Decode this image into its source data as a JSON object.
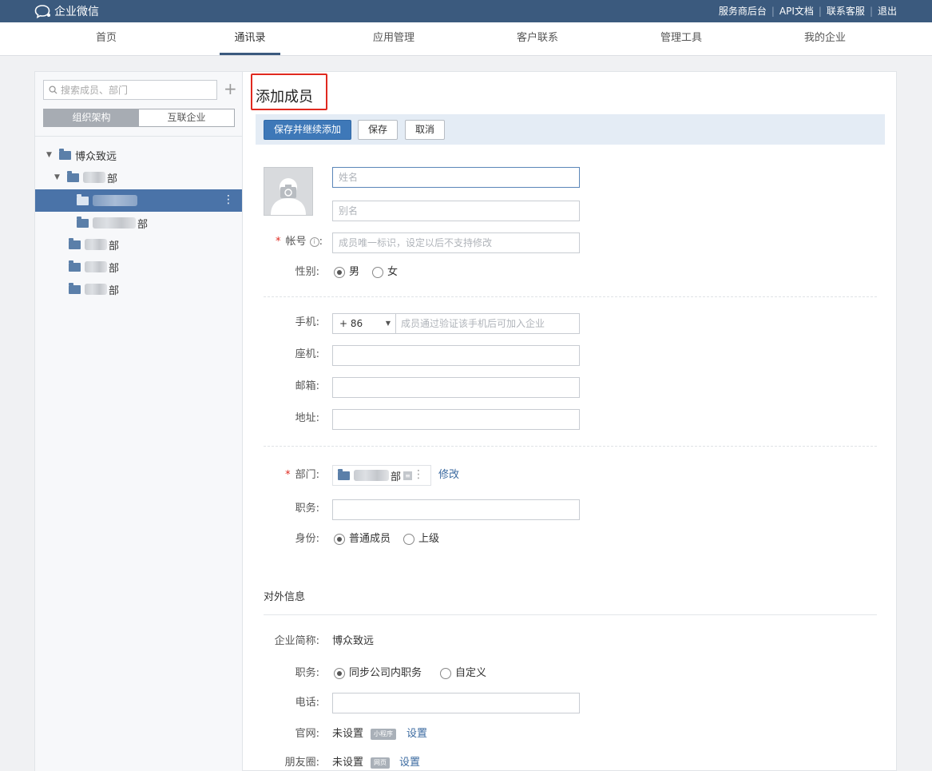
{
  "topbar": {
    "app_name": "企业微信",
    "links": [
      "服务商后台",
      "API文档",
      "联系客服",
      "退出"
    ],
    "separator": "|"
  },
  "nav": {
    "tabs": [
      "首页",
      "通讯录",
      "应用管理",
      "客户联系",
      "管理工具",
      "我的企业"
    ],
    "active": "通讯录"
  },
  "sidebar": {
    "search_placeholder": "搜索成员、部门",
    "segments": [
      "组织架构",
      "互联企业"
    ],
    "active_segment": "组织架构",
    "tree": {
      "root": "博众致远",
      "dept_suffix": "部"
    }
  },
  "form": {
    "title": "添加成员",
    "buttons": {
      "save_continue": "保存并继续添加",
      "save": "保存",
      "cancel": "取消"
    },
    "name_placeholder": "姓名",
    "alias_placeholder": "别名",
    "account_label": "帐号",
    "account_placeholder": "成员唯一标识，设定以后不支持修改",
    "gender_label": "性别:",
    "gender_options": [
      "男",
      "女"
    ],
    "gender_selected": "男",
    "mobile_label": "手机:",
    "country_code": "+ 86",
    "mobile_placeholder": "成员通过验证该手机后可加入企业",
    "landline_label": "座机:",
    "email_label": "邮箱:",
    "address_label": "地址:",
    "dept_label": "部门:",
    "dept_value_suffix": "部",
    "dept_modify": "修改",
    "position_label": "职务:",
    "identity_label": "身份:",
    "identity_options": [
      "普通成员",
      "上级"
    ],
    "identity_selected": "普通成员",
    "external": {
      "section_title": "对外信息",
      "corp_short_label": "企业简称:",
      "corp_short_value": "博众致远",
      "position_label": "职务:",
      "position_options": [
        "同步公司内职务",
        "自定义"
      ],
      "position_selected": "同步公司内职务",
      "phone_label": "电话:",
      "website_label": "官网:",
      "website_status": "未设置",
      "website_tag": "小程序",
      "website_action": "设置",
      "moments_label": "朋友圈:",
      "moments_status": "未设置",
      "moments_tag": "网页",
      "moments_action": "设置"
    }
  },
  "colors": {
    "topbar": "#3b5a7e",
    "accent": "#3e78b8",
    "selected_row": "#4a73a8",
    "required": "#e0291f"
  }
}
